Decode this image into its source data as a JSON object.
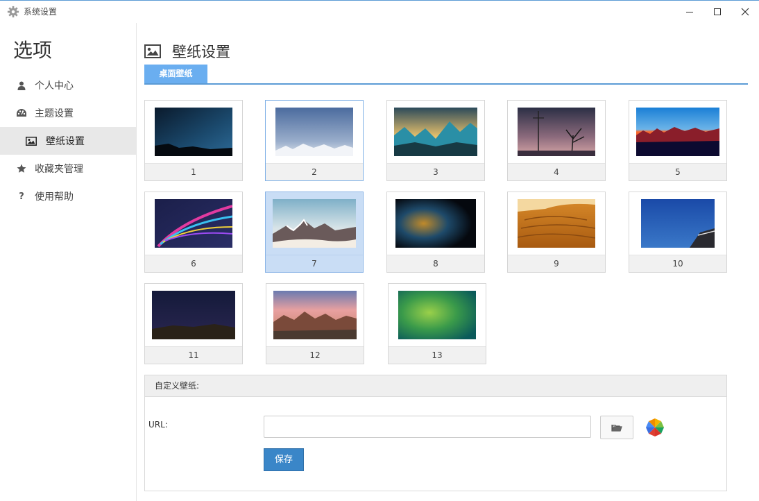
{
  "window": {
    "title": "系统设置"
  },
  "sidebar": {
    "heading": "选项",
    "items": [
      {
        "label": "个人中心",
        "icon": "user-icon"
      },
      {
        "label": "主题设置",
        "icon": "palette-icon"
      },
      {
        "label": "壁纸设置",
        "icon": "image-icon",
        "active": true
      },
      {
        "label": "收藏夹管理",
        "icon": "star-icon"
      },
      {
        "label": "使用帮助",
        "icon": "question-icon"
      }
    ]
  },
  "main": {
    "title": "壁纸设置",
    "tabs": [
      {
        "label": "桌面壁纸",
        "active": true
      }
    ],
    "wallpapers": [
      {
        "label": "1"
      },
      {
        "label": "2",
        "state": "hover"
      },
      {
        "label": "3"
      },
      {
        "label": "4"
      },
      {
        "label": "5"
      },
      {
        "label": "6"
      },
      {
        "label": "7",
        "state": "selected"
      },
      {
        "label": "8"
      },
      {
        "label": "9"
      },
      {
        "label": "10"
      },
      {
        "label": "11"
      },
      {
        "label": "12"
      },
      {
        "label": "13"
      }
    ],
    "custom": {
      "heading": "自定义壁纸:",
      "url_label": "URL:",
      "url_value": "",
      "save_label": "保存"
    }
  },
  "colors": {
    "accent": "#5b9bd5",
    "tab": "#6aaef0",
    "save_button": "#3a86c8",
    "selected": "#c9ddf5"
  }
}
